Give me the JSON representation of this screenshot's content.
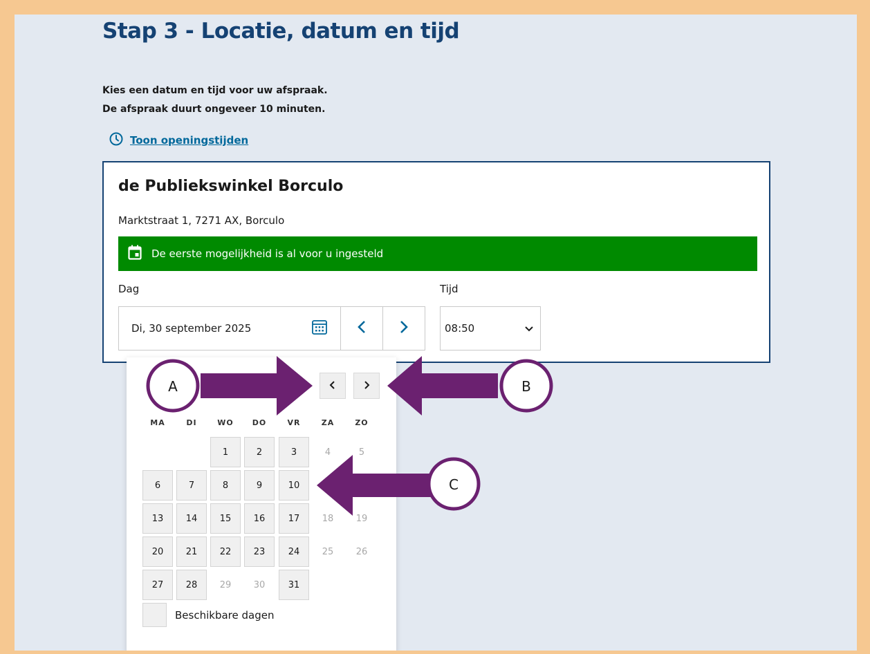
{
  "page": {
    "title": "Stap 3 - Locatie, datum en tijd",
    "intro_line1": "Kies een datum en tijd voor uw afspraak.",
    "intro_line2": "De afspraak duurt ongeveer 10 minuten.",
    "hours_link": "Toon openingstijden"
  },
  "location": {
    "name": "de Publiekswinkel Borculo",
    "address": "Marktstraat 1, 7271 AX, Borculo",
    "banner": "De eerste mogelijkheid is al voor u ingesteld"
  },
  "form": {
    "day_label": "Dag",
    "time_label": "Tijd",
    "date_value": "Di, 30 september 2025",
    "time_value": "08:50"
  },
  "calendar": {
    "weekdays": [
      "MA",
      "DI",
      "WO",
      "DO",
      "VR",
      "ZA",
      "ZO"
    ],
    "legend": "Beschikbare dagen",
    "weeks": [
      [
        null,
        null,
        {
          "d": "1",
          "a": true
        },
        {
          "d": "2",
          "a": true
        },
        {
          "d": "3",
          "a": true
        },
        {
          "d": "4",
          "a": false
        },
        {
          "d": "5",
          "a": false
        }
      ],
      [
        {
          "d": "6",
          "a": true
        },
        {
          "d": "7",
          "a": true
        },
        {
          "d": "8",
          "a": true
        },
        {
          "d": "9",
          "a": true
        },
        {
          "d": "10",
          "a": true
        },
        null,
        null
      ],
      [
        {
          "d": "13",
          "a": true
        },
        {
          "d": "14",
          "a": true
        },
        {
          "d": "15",
          "a": true
        },
        {
          "d": "16",
          "a": true
        },
        {
          "d": "17",
          "a": true
        },
        {
          "d": "18",
          "a": false
        },
        {
          "d": "19",
          "a": false
        }
      ],
      [
        {
          "d": "20",
          "a": true
        },
        {
          "d": "21",
          "a": true
        },
        {
          "d": "22",
          "a": true
        },
        {
          "d": "23",
          "a": true
        },
        {
          "d": "24",
          "a": true
        },
        {
          "d": "25",
          "a": false
        },
        {
          "d": "26",
          "a": false
        }
      ],
      [
        {
          "d": "27",
          "a": true
        },
        {
          "d": "28",
          "a": true
        },
        {
          "d": "29",
          "a": false
        },
        {
          "d": "30",
          "a": false
        },
        {
          "d": "31",
          "a": true
        },
        null,
        null
      ]
    ]
  },
  "annotations": {
    "a": "A",
    "b": "B",
    "c": "C"
  },
  "colors": {
    "brand_blue": "#154273",
    "link_blue": "#01689b",
    "banner_green": "#008a00",
    "arrow_purple": "#6b2170",
    "frame_orange": "#f6c891"
  }
}
